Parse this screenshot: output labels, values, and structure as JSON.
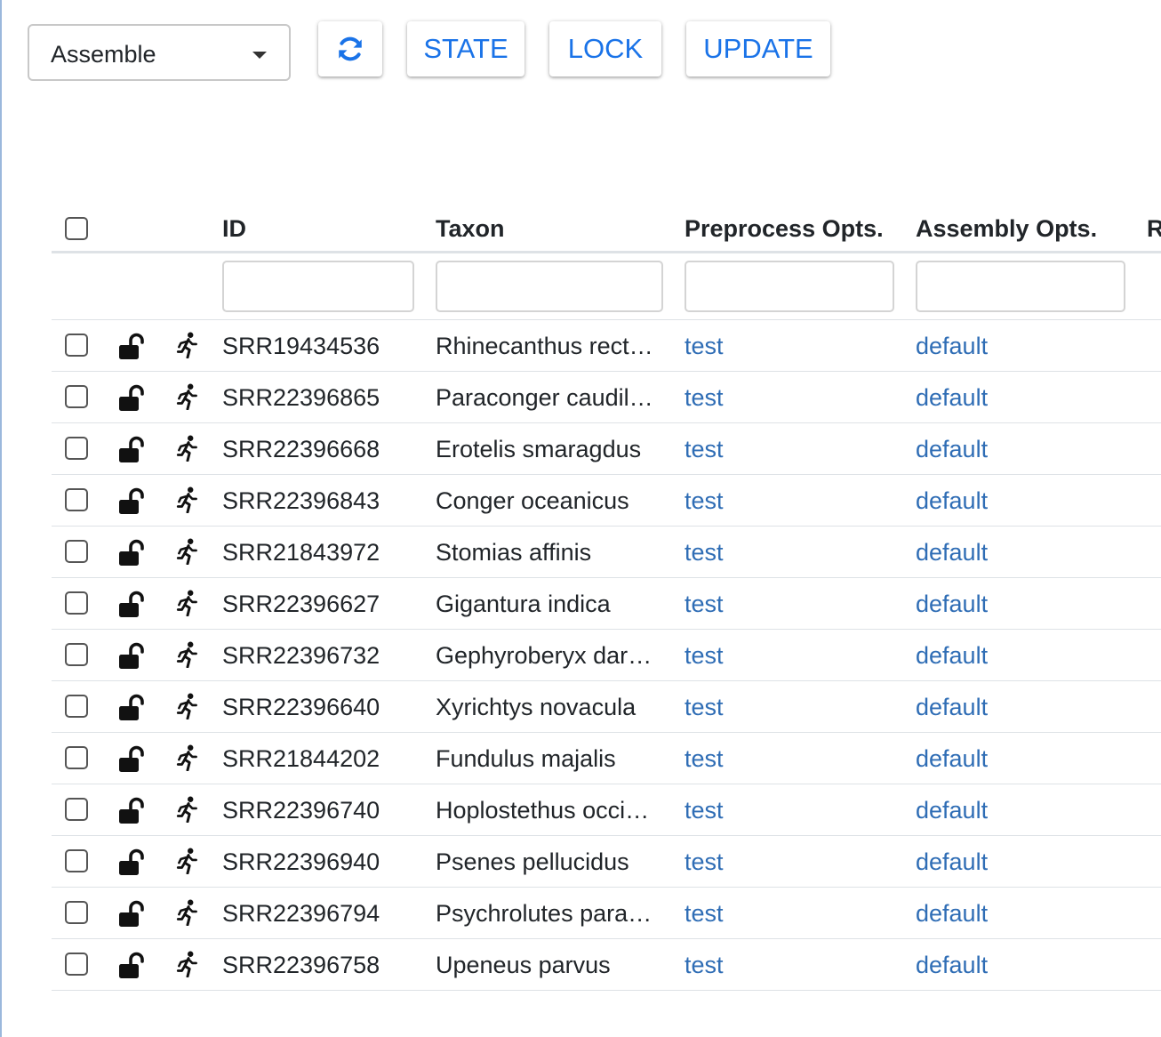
{
  "toolbar": {
    "dropdown_value": "Assemble",
    "state_label": "STATE",
    "lock_label": "LOCK",
    "update_label": "UPDATE"
  },
  "table": {
    "columns": [
      "ID",
      "Taxon",
      "Preprocess Opts.",
      "Assembly Opts.",
      "R"
    ],
    "rows": [
      {
        "id": "SRR19434536",
        "taxon": "Rhinecanthus rect…",
        "preprocess": "test",
        "assembly": "default"
      },
      {
        "id": "SRR22396865",
        "taxon": "Paraconger caudil…",
        "preprocess": "test",
        "assembly": "default"
      },
      {
        "id": "SRR22396668",
        "taxon": "Erotelis smaragdus",
        "preprocess": "test",
        "assembly": "default"
      },
      {
        "id": "SRR22396843",
        "taxon": "Conger oceanicus",
        "preprocess": "test",
        "assembly": "default"
      },
      {
        "id": "SRR21843972",
        "taxon": "Stomias affinis",
        "preprocess": "test",
        "assembly": "default"
      },
      {
        "id": "SRR22396627",
        "taxon": "Gigantura indica",
        "preprocess": "test",
        "assembly": "default"
      },
      {
        "id": "SRR22396732",
        "taxon": "Gephyroberyx dar…",
        "preprocess": "test",
        "assembly": "default"
      },
      {
        "id": "SRR22396640",
        "taxon": "Xyrichtys novacula",
        "preprocess": "test",
        "assembly": "default"
      },
      {
        "id": "SRR21844202",
        "taxon": "Fundulus majalis",
        "preprocess": "test",
        "assembly": "default"
      },
      {
        "id": "SRR22396740",
        "taxon": "Hoplostethus occi…",
        "preprocess": "test",
        "assembly": "default"
      },
      {
        "id": "SRR22396940",
        "taxon": "Psenes pellucidus",
        "preprocess": "test",
        "assembly": "default"
      },
      {
        "id": "SRR22396794",
        "taxon": "Psychrolutes para…",
        "preprocess": "test",
        "assembly": "default"
      },
      {
        "id": "SRR22396758",
        "taxon": "Upeneus parvus",
        "preprocess": "test",
        "assembly": "default"
      }
    ]
  },
  "colors": {
    "accent": "#1a73e8",
    "link": "#2f6db5"
  },
  "icons": {
    "refresh": "refresh-icon",
    "lock": "unlocked-lock-icon",
    "run": "running-person-icon"
  }
}
